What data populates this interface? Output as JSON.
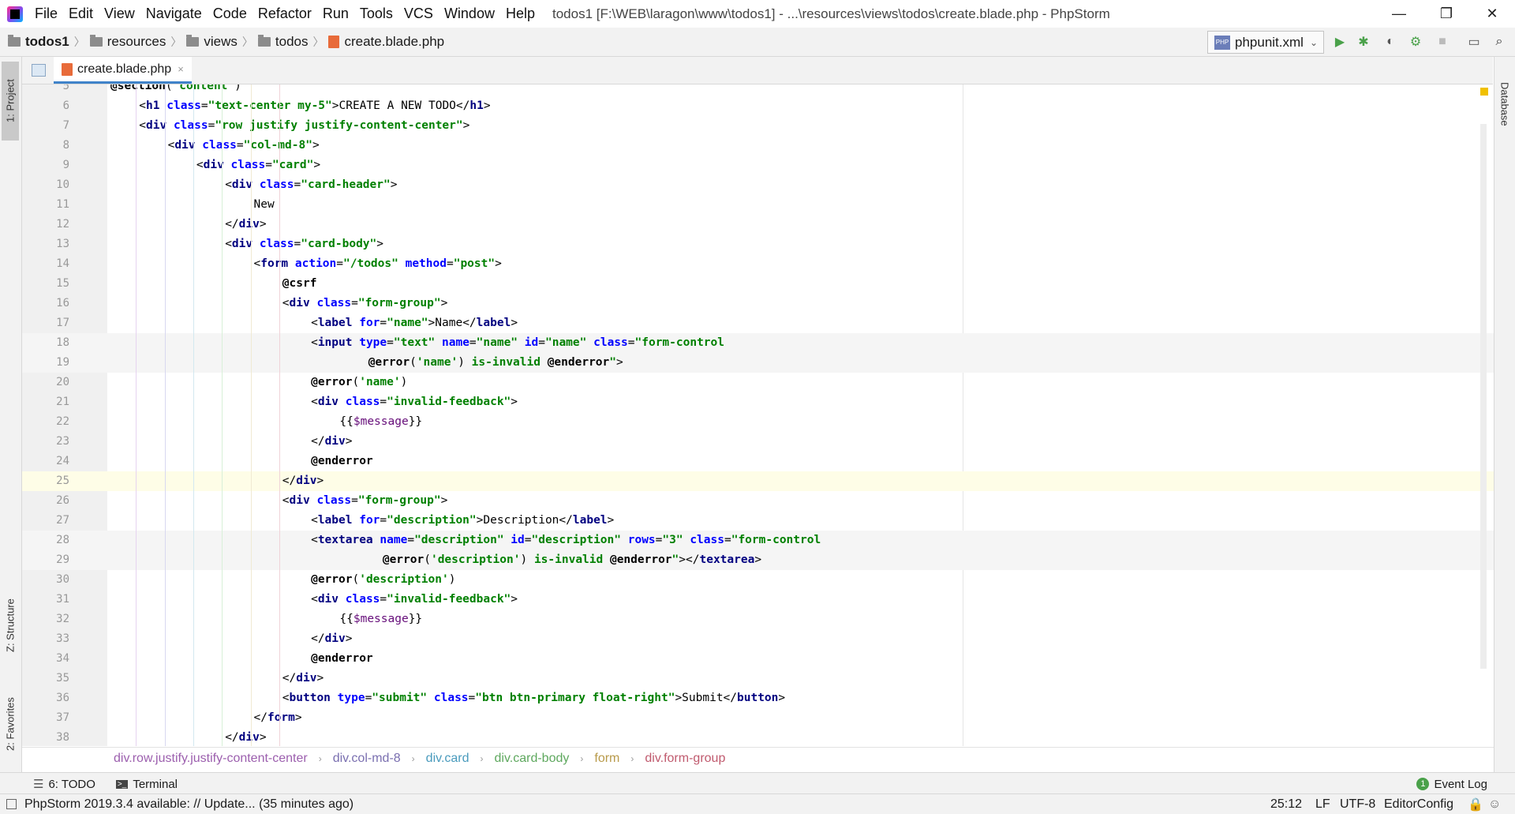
{
  "window": {
    "menu": [
      "File",
      "Edit",
      "View",
      "Navigate",
      "Code",
      "Refactor",
      "Run",
      "Tools",
      "VCS",
      "Window",
      "Help"
    ],
    "title": "todos1 [F:\\WEB\\laragon\\www\\todos1] - ...\\resources\\views\\todos\\create.blade.php - PhpStorm",
    "minimize": "—",
    "maximize": "❐",
    "close": "✕"
  },
  "navbar": {
    "crumbs": [
      "todos1",
      "resources",
      "views",
      "todos",
      "create.blade.php"
    ],
    "run_config": "phpunit.xml",
    "run_config_badge": "PHP"
  },
  "left_strip": {
    "project": "1: Project",
    "structure": "Z: Structure",
    "favorites": "2: Favorites"
  },
  "right_strip": {
    "database": "Database"
  },
  "tab": {
    "label": "create.blade.php",
    "close": "×"
  },
  "editor": {
    "lines": [
      {
        "n": "5",
        "fold": "⌄",
        "tokens": [
          [
            "kw",
            "@section"
          ],
          [
            "txt",
            "("
          ],
          [
            "str",
            "'content'"
          ],
          [
            "txt",
            ")"
          ]
        ],
        "indent": 0
      },
      {
        "n": "6",
        "fold": "›",
        "tokens": [
          [
            "txt",
            "<"
          ],
          [
            "tag",
            "h1 "
          ],
          [
            "attr",
            "class"
          ],
          [
            "txt",
            "="
          ],
          [
            "str",
            "\"text-center my-5\""
          ],
          [
            "txt",
            ">CREATE A NEW TODO</"
          ],
          [
            "tag",
            "h1"
          ],
          [
            "txt",
            ">"
          ]
        ],
        "indent": 1
      },
      {
        "n": "7",
        "fold": "›",
        "tokens": [
          [
            "txt",
            "<"
          ],
          [
            "tag",
            "div "
          ],
          [
            "attr",
            "class"
          ],
          [
            "txt",
            "="
          ],
          [
            "str",
            "\"row justify justify-content-center\""
          ],
          [
            "txt",
            ">"
          ]
        ],
        "indent": 1
      },
      {
        "n": "8",
        "fold": "›",
        "tokens": [
          [
            "txt",
            "<"
          ],
          [
            "tag",
            "div "
          ],
          [
            "attr",
            "class"
          ],
          [
            "txt",
            "="
          ],
          [
            "str",
            "\"col-md-8\""
          ],
          [
            "txt",
            ">"
          ]
        ],
        "indent": 2
      },
      {
        "n": "9",
        "fold": "›",
        "tokens": [
          [
            "txt",
            "<"
          ],
          [
            "tag",
            "div "
          ],
          [
            "attr",
            "class"
          ],
          [
            "txt",
            "="
          ],
          [
            "str",
            "\"card\""
          ],
          [
            "txt",
            ">"
          ]
        ],
        "indent": 3
      },
      {
        "n": "10",
        "fold": "›",
        "tokens": [
          [
            "txt",
            "<"
          ],
          [
            "tag",
            "div "
          ],
          [
            "attr",
            "class"
          ],
          [
            "txt",
            "="
          ],
          [
            "str",
            "\"card-header\""
          ],
          [
            "txt",
            ">"
          ]
        ],
        "indent": 4
      },
      {
        "n": "11",
        "fold": "⌄",
        "tokens": [
          [
            "txt",
            "New"
          ]
        ],
        "indent": 5
      },
      {
        "n": "12",
        "fold": "",
        "tokens": [
          [
            "txt",
            "</"
          ],
          [
            "tag",
            "div"
          ],
          [
            "txt",
            ">"
          ]
        ],
        "indent": 4
      },
      {
        "n": "13",
        "fold": "",
        "tokens": [
          [
            "txt",
            "<"
          ],
          [
            "tag",
            "div "
          ],
          [
            "attr",
            "class"
          ],
          [
            "txt",
            "="
          ],
          [
            "str",
            "\"card-body\""
          ],
          [
            "txt",
            ">"
          ]
        ],
        "indent": 4
      },
      {
        "n": "14",
        "fold": "",
        "tokens": [
          [
            "txt",
            "<"
          ],
          [
            "tag",
            "form "
          ],
          [
            "attr",
            "action"
          ],
          [
            "txt",
            "="
          ],
          [
            "str",
            "\"/todos\""
          ],
          [
            "txt",
            " "
          ],
          [
            "attr",
            "method"
          ],
          [
            "txt",
            "="
          ],
          [
            "str",
            "\"post\""
          ],
          [
            "txt",
            ">"
          ]
        ],
        "indent": 5
      },
      {
        "n": "15",
        "fold": "",
        "tokens": [
          [
            "kw",
            "@csrf"
          ]
        ],
        "indent": 6
      },
      {
        "n": "16",
        "fold": "",
        "tokens": [
          [
            "txt",
            "<"
          ],
          [
            "tag",
            "div "
          ],
          [
            "attr",
            "class"
          ],
          [
            "txt",
            "="
          ],
          [
            "str",
            "\"form-group\""
          ],
          [
            "txt",
            ">"
          ]
        ],
        "indent": 6
      },
      {
        "n": "17",
        "fold": "",
        "tokens": [
          [
            "txt",
            "<"
          ],
          [
            "tag",
            "label "
          ],
          [
            "attr",
            "for"
          ],
          [
            "txt",
            "="
          ],
          [
            "str",
            "\"name\""
          ],
          [
            "txt",
            ">Name</"
          ],
          [
            "tag",
            "label"
          ],
          [
            "txt",
            ">"
          ]
        ],
        "indent": 7
      },
      {
        "n": "18",
        "fold": "",
        "tokens": [
          [
            "txt",
            "<"
          ],
          [
            "tag",
            "input "
          ],
          [
            "attr",
            "type"
          ],
          [
            "txt",
            "="
          ],
          [
            "str",
            "\"text\""
          ],
          [
            "txt",
            " "
          ],
          [
            "attr",
            "name"
          ],
          [
            "txt",
            "="
          ],
          [
            "str",
            "\"name\""
          ],
          [
            "txt",
            " "
          ],
          [
            "attr",
            "id"
          ],
          [
            "txt",
            "="
          ],
          [
            "str",
            "\"name\""
          ],
          [
            "txt",
            " "
          ],
          [
            "attr",
            "class"
          ],
          [
            "txt",
            "="
          ],
          [
            "str",
            "\"form-control"
          ]
        ],
        "indent": 7,
        "hl": true
      },
      {
        "n": "19",
        "fold": "",
        "tokens": [
          [
            "kw",
            "@error"
          ],
          [
            "txt",
            "("
          ],
          [
            "str",
            "'name'"
          ],
          [
            "txt",
            ") "
          ],
          [
            "str",
            "is-invalid "
          ],
          [
            "kw",
            "@enderror"
          ],
          [
            "str",
            "\""
          ],
          [
            "txt",
            ">"
          ]
        ],
        "indent": 9,
        "hl": true
      },
      {
        "n": "20",
        "fold": "",
        "tokens": [
          [
            "kw",
            "@error"
          ],
          [
            "txt",
            "("
          ],
          [
            "str",
            "'name'"
          ],
          [
            "txt",
            ")"
          ]
        ],
        "indent": 7
      },
      {
        "n": "21",
        "fold": "",
        "tokens": [
          [
            "txt",
            "<"
          ],
          [
            "tag",
            "div "
          ],
          [
            "attr",
            "class"
          ],
          [
            "txt",
            "="
          ],
          [
            "str",
            "\"invalid-feedback\""
          ],
          [
            "txt",
            ">"
          ]
        ],
        "indent": 7
      },
      {
        "n": "22",
        "fold": "",
        "tokens": [
          [
            "txt",
            "{{"
          ],
          [
            "varx",
            "$message"
          ],
          [
            "txt",
            "}}"
          ]
        ],
        "indent": 8
      },
      {
        "n": "23",
        "fold": "",
        "tokens": [
          [
            "txt",
            "</"
          ],
          [
            "tag",
            "div"
          ],
          [
            "txt",
            ">"
          ]
        ],
        "indent": 7
      },
      {
        "n": "24",
        "fold": "",
        "tokens": [
          [
            "kw",
            "@enderror"
          ]
        ],
        "indent": 7
      },
      {
        "n": "25",
        "fold": "",
        "tokens": [
          [
            "txt",
            "</"
          ],
          [
            "tag",
            "div"
          ],
          [
            "txt",
            ">"
          ]
        ],
        "indent": 6,
        "cur": true
      },
      {
        "n": "26",
        "fold": "›",
        "tokens": [
          [
            "txt",
            "<"
          ],
          [
            "tag",
            "div "
          ],
          [
            "attr",
            "class"
          ],
          [
            "txt",
            "="
          ],
          [
            "str",
            "\"form-group\""
          ],
          [
            "txt",
            ">"
          ]
        ],
        "indent": 6
      },
      {
        "n": "27",
        "fold": "›",
        "tokens": [
          [
            "txt",
            "<"
          ],
          [
            "tag",
            "label "
          ],
          [
            "attr",
            "for"
          ],
          [
            "txt",
            "="
          ],
          [
            "str",
            "\"description\""
          ],
          [
            "txt",
            ">Description</"
          ],
          [
            "tag",
            "label"
          ],
          [
            "txt",
            ">"
          ]
        ],
        "indent": 7
      },
      {
        "n": "28",
        "fold": "›",
        "tokens": [
          [
            "txt",
            "<"
          ],
          [
            "tag",
            "textarea "
          ],
          [
            "attr",
            "name"
          ],
          [
            "txt",
            "="
          ],
          [
            "str",
            "\"description\""
          ],
          [
            "txt",
            " "
          ],
          [
            "attr",
            "id"
          ],
          [
            "txt",
            "="
          ],
          [
            "str",
            "\"description\""
          ],
          [
            "txt",
            " "
          ],
          [
            "attr",
            "rows"
          ],
          [
            "txt",
            "="
          ],
          [
            "str",
            "\"3\""
          ],
          [
            "txt",
            " "
          ],
          [
            "attr",
            "class"
          ],
          [
            "txt",
            "="
          ],
          [
            "str",
            "\"form-control"
          ]
        ],
        "indent": 7,
        "hl": true
      },
      {
        "n": "29",
        "fold": "›",
        "tokens": [
          [
            "kw",
            "@error"
          ],
          [
            "txt",
            "("
          ],
          [
            "str",
            "'description'"
          ],
          [
            "txt",
            ") "
          ],
          [
            "str",
            "is-invalid "
          ],
          [
            "kw",
            "@enderror"
          ],
          [
            "str",
            "\""
          ],
          [
            "txt",
            ">"
          ],
          [
            "txt",
            "</"
          ],
          [
            "tag",
            "textarea"
          ],
          [
            "txt",
            ">"
          ]
        ],
        "indent": 9.5,
        "hl": true
      },
      {
        "n": "30",
        "fold": "",
        "tokens": [
          [
            "kw",
            "@error"
          ],
          [
            "txt",
            "("
          ],
          [
            "str",
            "'description'"
          ],
          [
            "txt",
            ")"
          ]
        ],
        "indent": 7
      },
      {
        "n": "31",
        "fold": "",
        "tokens": [
          [
            "txt",
            "<"
          ],
          [
            "tag",
            "div "
          ],
          [
            "attr",
            "class"
          ],
          [
            "txt",
            "="
          ],
          [
            "str",
            "\"invalid-feedback\""
          ],
          [
            "txt",
            ">"
          ]
        ],
        "indent": 7
      },
      {
        "n": "32",
        "fold": "",
        "tokens": [
          [
            "txt",
            "{{"
          ],
          [
            "varx",
            "$message"
          ],
          [
            "txt",
            "}}"
          ]
        ],
        "indent": 8
      },
      {
        "n": "33",
        "fold": "",
        "tokens": [
          [
            "txt",
            "</"
          ],
          [
            "tag",
            "div"
          ],
          [
            "txt",
            ">"
          ]
        ],
        "indent": 7
      },
      {
        "n": "34",
        "fold": "",
        "tokens": [
          [
            "kw",
            "@enderror"
          ]
        ],
        "indent": 7
      },
      {
        "n": "35",
        "fold": "",
        "tokens": [
          [
            "txt",
            "</"
          ],
          [
            "tag",
            "div"
          ],
          [
            "txt",
            ">"
          ]
        ],
        "indent": 6
      },
      {
        "n": "36",
        "fold": "",
        "tokens": [
          [
            "txt",
            "<"
          ],
          [
            "tag",
            "button "
          ],
          [
            "attr",
            "type"
          ],
          [
            "txt",
            "="
          ],
          [
            "str",
            "\"submit\""
          ],
          [
            "txt",
            " "
          ],
          [
            "attr",
            "class"
          ],
          [
            "txt",
            "="
          ],
          [
            "str",
            "\"btn btn-primary float-right\""
          ],
          [
            "txt",
            ">Submit</"
          ],
          [
            "tag",
            "button"
          ],
          [
            "txt",
            ">"
          ]
        ],
        "indent": 6
      },
      {
        "n": "37",
        "fold": "",
        "tokens": [
          [
            "txt",
            "</"
          ],
          [
            "tag",
            "form"
          ],
          [
            "txt",
            ">"
          ]
        ],
        "indent": 5
      },
      {
        "n": "38",
        "fold": "",
        "tokens": [
          [
            "txt",
            "</"
          ],
          [
            "tag",
            "div"
          ],
          [
            "txt",
            ">"
          ]
        ],
        "indent": 4
      }
    ]
  },
  "code_breadcrumbs": [
    {
      "label": "div.row.justify.justify-content-center",
      "color": "#9c5fae"
    },
    {
      "label": "div.col-md-8",
      "color": "#7a6fb0"
    },
    {
      "label": "div.card",
      "color": "#4a9bbd"
    },
    {
      "label": "div.card-body",
      "color": "#5ea85e"
    },
    {
      "label": "form",
      "color": "#b89a4a"
    },
    {
      "label": "div.form-group",
      "color": "#c05a6e"
    }
  ],
  "bottom_tabs": {
    "todo": "6: TODO",
    "terminal": "Terminal",
    "event_log": "Event Log",
    "event_count": "1"
  },
  "status": {
    "message": "PhpStorm 2019.3.4 available: // Update... (35 minutes ago)",
    "position": "25:12",
    "line_sep": "LF",
    "encoding": "UTF-8",
    "editorconfig": "EditorConfig"
  }
}
